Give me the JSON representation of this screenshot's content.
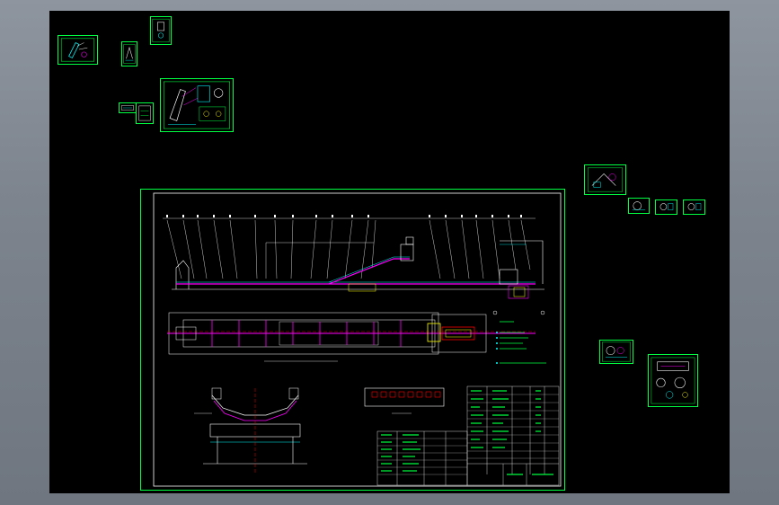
{
  "app": {
    "window_title": ""
  },
  "canvas": {
    "background": "#000000",
    "line_color_primary": "#00ff40",
    "accent_colors": [
      "#00ffff",
      "#ff00ff",
      "#ffff00",
      "#ff0000",
      "#ffffff"
    ]
  },
  "thumbnails": [
    {
      "id": "sheet-a"
    },
    {
      "id": "sheet-b"
    },
    {
      "id": "sheet-c"
    },
    {
      "id": "sheet-d"
    },
    {
      "id": "sheet-e"
    },
    {
      "id": "sheet-f"
    },
    {
      "id": "sheet-g"
    },
    {
      "id": "sheet-h"
    },
    {
      "id": "sheet-i"
    },
    {
      "id": "sheet-j"
    },
    {
      "id": "sheet-k"
    },
    {
      "id": "sheet-l"
    }
  ],
  "main_drawing": {
    "notes_heading": "",
    "title_block_rows": 12
  }
}
